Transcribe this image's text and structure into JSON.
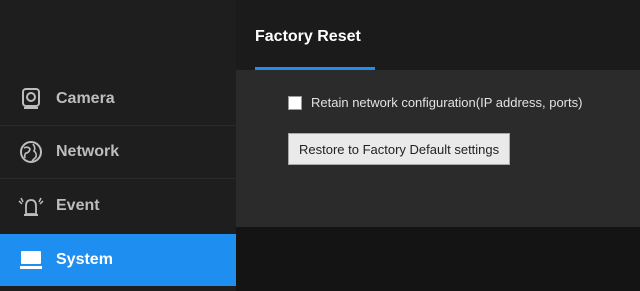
{
  "sidebar": {
    "items": [
      {
        "label": "Camera",
        "icon": "camera-icon"
      },
      {
        "label": "Network",
        "icon": "globe-icon"
      },
      {
        "label": "Event",
        "icon": "alarm-icon"
      },
      {
        "label": "System",
        "icon": "monitor-icon",
        "active": true
      }
    ]
  },
  "main": {
    "tab_title": "Factory Reset",
    "retain_label": "Retain network configuration(IP address, ports)",
    "retain_checked": false,
    "restore_button": "Restore to Factory Default settings"
  },
  "colors": {
    "accent": "#1e8ef0",
    "sidebar_bg": "#1e1e1e",
    "panel_bg": "#2b2b2b"
  }
}
